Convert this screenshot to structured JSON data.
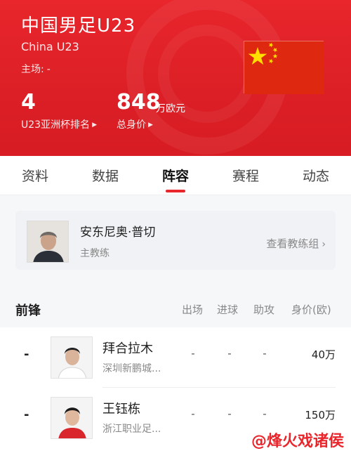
{
  "header": {
    "team_name": "中国男足U23",
    "team_en": "China U23",
    "home_label": "主场:",
    "home_value": "-",
    "stats": [
      {
        "value": "4",
        "unit": "",
        "label": "U23亚洲杯排名"
      },
      {
        "value": "848",
        "unit": "万欧元",
        "label": "总身价"
      }
    ],
    "flag_icon": "china-flag-icon",
    "accent_color": "#e8262c"
  },
  "tabs": [
    {
      "label": "资料"
    },
    {
      "label": "数据"
    },
    {
      "label": "阵容",
      "active": true
    },
    {
      "label": "赛程"
    },
    {
      "label": "动态"
    }
  ],
  "coach": {
    "name": "安东尼奥·普切",
    "role": "主教练",
    "link_label": "查看教练组"
  },
  "position_group": {
    "title": "前锋",
    "columns": [
      "出场",
      "进球",
      "助攻",
      "身价(欧)"
    ]
  },
  "players": [
    {
      "number": "-",
      "name": "拜合拉木",
      "club": "深圳新鹏城...",
      "apps": "-",
      "goals": "-",
      "assists": "-",
      "value": "40万"
    },
    {
      "number": "-",
      "name": "王钰栋",
      "club": "浙江职业足...",
      "apps": "-",
      "goals": "-",
      "assists": "-",
      "value": "150万"
    }
  ],
  "credit": "@烽火戏诸侯"
}
